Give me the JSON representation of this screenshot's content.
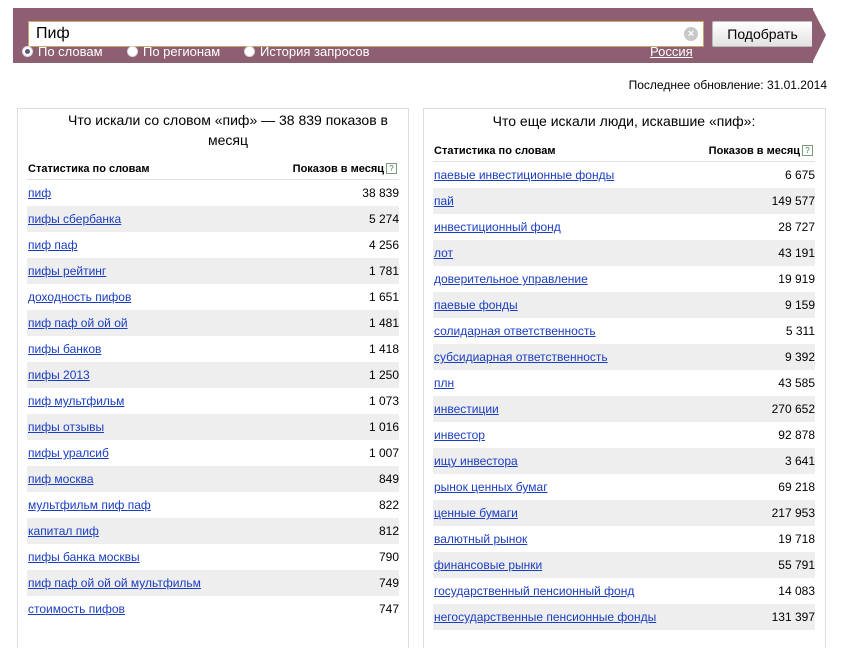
{
  "search": {
    "value": "Пиф",
    "submit_label": "Подобрать",
    "clear_icon": "close-icon"
  },
  "modes": [
    {
      "label": "По словам",
      "selected": true
    },
    {
      "label": "По регионам",
      "selected": false
    },
    {
      "label": "История запросов",
      "selected": false
    }
  ],
  "region": "Россия",
  "last_update": "Последнее обновление: 31.01.2014",
  "colors": {
    "topbar": "#8e5e73",
    "link": "#1a3dc1",
    "row_alt": "#eeeeee"
  },
  "left_panel": {
    "title": "Что искали со словом «пиф» — 38 839 показов в месяц",
    "col_query": "Статистика по словам",
    "col_count": "Показов в месяц",
    "help": "?",
    "rows": [
      {
        "q": "пиф",
        "n": "38 839"
      },
      {
        "q": "пифы сбербанка",
        "n": "5 274"
      },
      {
        "q": "пиф паф",
        "n": "4 256"
      },
      {
        "q": "пифы рейтинг",
        "n": "1 781"
      },
      {
        "q": "доходность пифов",
        "n": "1 651"
      },
      {
        "q": "пиф паф ой ой ой",
        "n": "1 481"
      },
      {
        "q": "пифы банков",
        "n": "1 418"
      },
      {
        "q": "пифы 2013",
        "n": "1 250"
      },
      {
        "q": "пиф мультфильм",
        "n": "1 073"
      },
      {
        "q": "пифы отзывы",
        "n": "1 016"
      },
      {
        "q": "пифы уралсиб",
        "n": "1 007"
      },
      {
        "q": "пиф москва",
        "n": "849"
      },
      {
        "q": "мультфильм пиф паф",
        "n": "822"
      },
      {
        "q": "капитал пиф",
        "n": "812"
      },
      {
        "q": "пифы банка москвы",
        "n": "790"
      },
      {
        "q": "пиф паф ой ой ой мультфильм",
        "n": "749"
      },
      {
        "q": "стоимость пифов",
        "n": "747"
      }
    ]
  },
  "right_panel": {
    "title": "Что еще искали люди, искавшие «пиф»:",
    "col_query": "Статистика по словам",
    "col_count": "Показов в месяц",
    "help": "?",
    "rows": [
      {
        "q": "паевые инвестиционные фонды",
        "n": "6 675"
      },
      {
        "q": "пай",
        "n": "149 577"
      },
      {
        "q": "инвестиционный фонд",
        "n": "28 727"
      },
      {
        "q": "лот",
        "n": "43 191"
      },
      {
        "q": "доверительное управление",
        "n": "19 919"
      },
      {
        "q": "паевые фонды",
        "n": "9 159"
      },
      {
        "q": "солидарная ответственность",
        "n": "5 311"
      },
      {
        "q": "субсидиарная ответственность",
        "n": "9 392"
      },
      {
        "q": "плн",
        "n": "43 585"
      },
      {
        "q": "инвестиции",
        "n": "270 652"
      },
      {
        "q": "инвестор",
        "n": "92 878"
      },
      {
        "q": "ищу инвестора",
        "n": "3 641"
      },
      {
        "q": "рынок ценных бумаг",
        "n": "69 218"
      },
      {
        "q": "ценные бумаги",
        "n": "217 953"
      },
      {
        "q": "валютный рынок",
        "n": "19 718"
      },
      {
        "q": "финансовые рынки",
        "n": "55 791"
      },
      {
        "q": "государственный пенсионный фонд",
        "n": "14 083"
      },
      {
        "q": "негосударственные пенсионные фонды",
        "n": "131 397"
      }
    ]
  }
}
